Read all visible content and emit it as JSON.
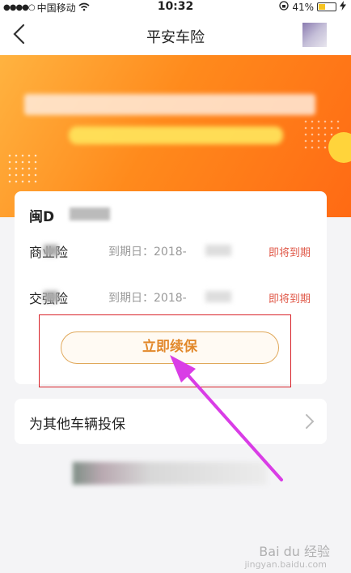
{
  "status_bar": {
    "carrier": "中国移动",
    "time": "10:32",
    "battery": "41%",
    "battery_level": 0.41
  },
  "nav": {
    "title": "平安车险"
  },
  "vehicle": {
    "plate": "闽D"
  },
  "policies": [
    {
      "label": "商业险",
      "date_label": "到期日：",
      "date": "2018-",
      "status": "即将到期"
    },
    {
      "label": "交强险",
      "date_label": "到期日：",
      "date": "2018-",
      "status": "即将到期"
    }
  ],
  "actions": {
    "renew": "立即续保",
    "other_vehicle": "为其他车辆投保"
  },
  "watermark": {
    "text": "Bai du 经验",
    "sub": "jingyan.baidu.com"
  },
  "colors": {
    "accent_orange": "#ff8a1c",
    "status_red": "#e05a4a",
    "button_text": "#e2892c",
    "highlight_box": "#d8232a",
    "arrow": "#d93de6"
  }
}
